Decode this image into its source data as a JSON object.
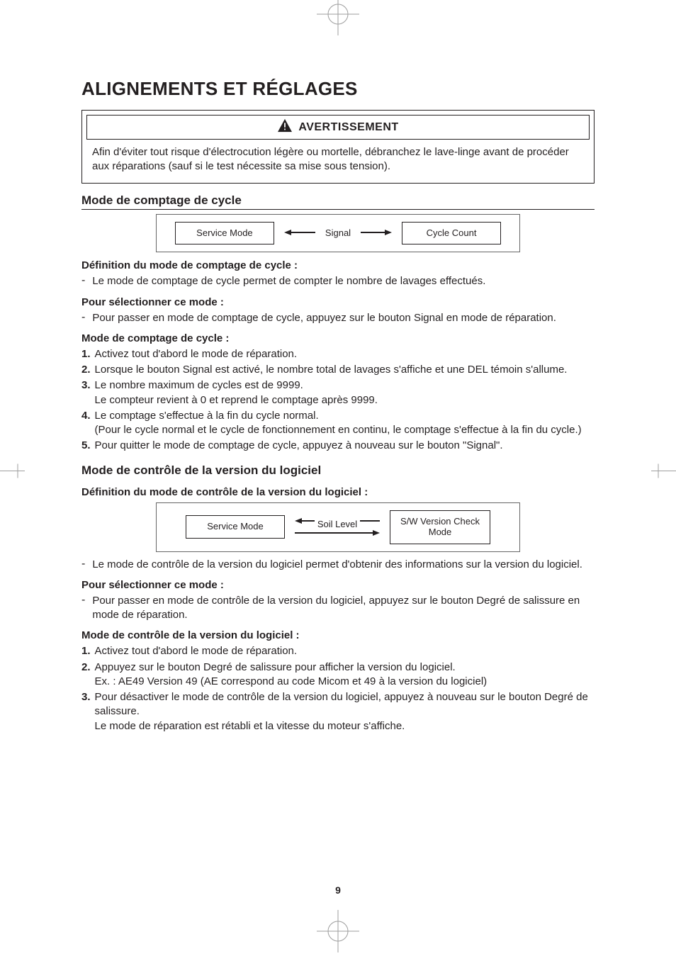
{
  "title": "ALIGNEMENTS ET RÉGLAGES",
  "warning": {
    "label": "AVERTISSEMENT",
    "body": "Afin d'éviter tout risque d'électrocution légère ou mortelle, débranchez le lave-linge avant de procéder aux réparations (sauf si le test nécessite sa mise sous tension)."
  },
  "cycle": {
    "heading": "Mode de comptage de cycle",
    "flow": {
      "left": "Service Mode",
      "mid": "Signal",
      "right": "Cycle Count"
    },
    "def_h": "Définition du mode de comptage de cycle :",
    "def_b": "Le mode de comptage de cycle permet de compter le nombre de lavages effectués.",
    "sel_h": "Pour sélectionner ce mode :",
    "sel_b": "Pour passer en mode de comptage de cycle, appuyez sur le bouton Signal en mode de réparation.",
    "mode_h": "Mode de comptage de cycle :",
    "steps": [
      {
        "n": "1.",
        "t": "Activez tout d'abord le mode de réparation."
      },
      {
        "n": "2.",
        "t": "Lorsque le bouton Signal est activé, le nombre total de lavages s'affiche et une DEL témoin s'allume."
      },
      {
        "n": "3.",
        "t": "Le nombre maximum de cycles est de 9999.",
        "s": "Le compteur revient à 0 et reprend le comptage après 9999."
      },
      {
        "n": "4.",
        "t": "Le comptage s'effectue à la fin du cycle normal.",
        "s": "(Pour le cycle normal et le cycle de fonctionnement en continu, le comptage s'effectue à la fin du cycle.)"
      },
      {
        "n": "5.",
        "t": "Pour quitter le mode de comptage de cycle, appuyez à nouveau sur le bouton \"Signal\"."
      }
    ]
  },
  "sw": {
    "heading": "Mode de contrôle de la version du logiciel",
    "def_h": "Définition du mode de contrôle de la version du logiciel :",
    "flow": {
      "left": "Service Mode",
      "mid": "Soil Level",
      "right": "S/W Version Check\nMode"
    },
    "def_b": "Le mode de contrôle de la version du logiciel permet d'obtenir des informations sur la version du logiciel.",
    "sel_h": "Pour sélectionner ce mode :",
    "sel_b": "Pour passer en mode de contrôle de la version du logiciel, appuyez sur le bouton Degré de salissure en mode de réparation.",
    "mode_h": "Mode de contrôle de la version du logiciel :",
    "steps": [
      {
        "n": "1.",
        "t": "Activez tout d'abord le mode de réparation."
      },
      {
        "n": "2.",
        "t": "Appuyez sur le bouton Degré de salissure pour afficher la version du logiciel.",
        "s": "Ex. : AE49 Version 49 (AE correspond au code Micom et 49 à la version du logiciel)"
      },
      {
        "n": "3.",
        "t": "Pour désactiver le mode de contrôle de la version du logiciel, appuyez à nouveau sur le bouton Degré de salissure.",
        "s": "Le mode de réparation est rétabli et la vitesse du moteur s'affiche."
      }
    ]
  },
  "page": "9"
}
